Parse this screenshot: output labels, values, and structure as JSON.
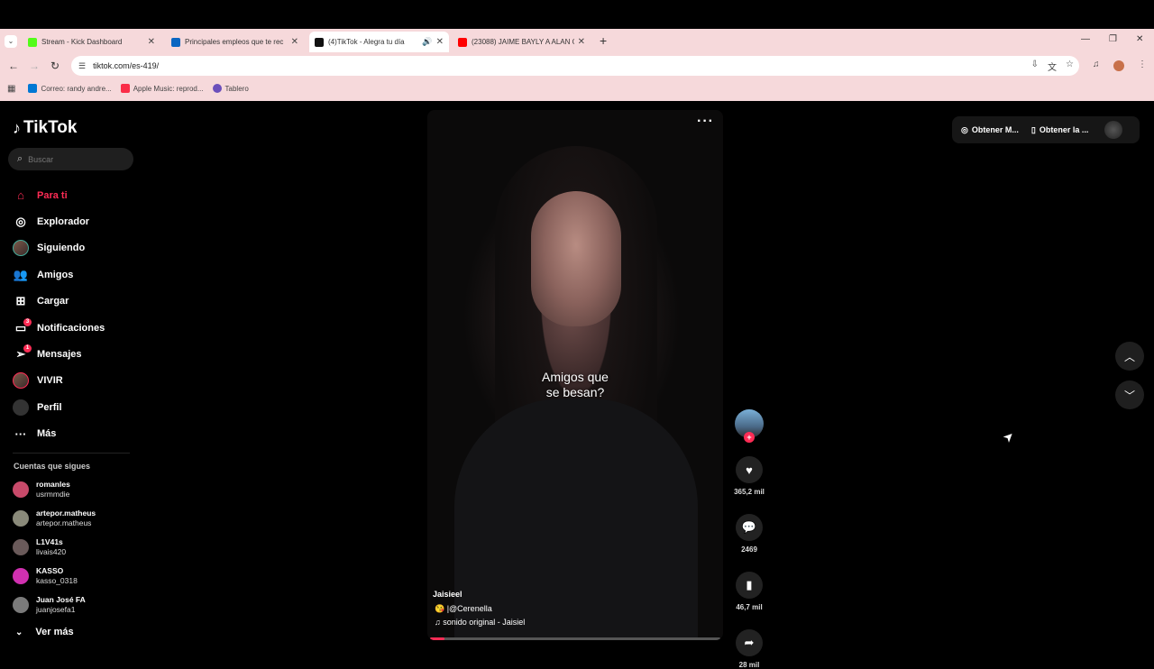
{
  "browser": {
    "tabs": [
      {
        "title": "Stream - Kick Dashboard",
        "favicon_color": "#53fc18",
        "active": false
      },
      {
        "title": "Principales empleos que te rec",
        "favicon_color": "#0a66c2",
        "active": false
      },
      {
        "title": "(4)TikTok - Alegra tu día",
        "favicon_color": "#111111",
        "active": true
      },
      {
        "title": "(23088) JAIME BAYLY A ALAN G",
        "favicon_color": "#ff0000",
        "active": false
      }
    ],
    "url": "tiktok.com/es-419/",
    "bookmarks": [
      {
        "label": "Correo: randy andre...",
        "color": "#0078d4"
      },
      {
        "label": "Apple Music: reprod...",
        "color": "#fa2d48"
      },
      {
        "label": "Tablero",
        "color": "#6b4fbb"
      }
    ]
  },
  "sidebar": {
    "logo": "TikTok",
    "search_placeholder": "Buscar",
    "nav": [
      {
        "label": "Para ti",
        "icon": "home-icon",
        "active": true
      },
      {
        "label": "Explorador",
        "icon": "compass-icon"
      },
      {
        "label": "Siguiendo",
        "icon": "following-avatar"
      },
      {
        "label": "Amigos",
        "icon": "friends-icon"
      },
      {
        "label": "Cargar",
        "icon": "upload-icon"
      },
      {
        "label": "Notificaciones",
        "icon": "inbox-icon",
        "badge": "3"
      },
      {
        "label": "Mensajes",
        "icon": "send-icon",
        "badge": "1"
      },
      {
        "label": "VIVIR",
        "icon": "live-icon"
      },
      {
        "label": "Perfil",
        "icon": "profile-avatar"
      },
      {
        "label": "Más",
        "icon": "more-icon"
      }
    ],
    "following_title": "Cuentas que sigues",
    "following": [
      {
        "name": "romanles",
        "handle": "usrmmdie",
        "color": "#c84a6a"
      },
      {
        "name": "artepor.matheus",
        "handle": "artepor.matheus",
        "color": "#8a8a7a"
      },
      {
        "name": "L1V41s",
        "handle": "livais420",
        "color": "#6a5a5a"
      },
      {
        "name": "KASSO",
        "handle": "kasso_0318",
        "color": "#d030b0"
      },
      {
        "name": "Juan José FA",
        "handle": "juanjosefa1",
        "color": "#7a7a7a"
      }
    ],
    "see_more": "Ver más"
  },
  "video": {
    "caption_line1": "Amigos que",
    "caption_line2": "se besan?",
    "author": "Jaisieel",
    "description": "😘 |@Cerenella",
    "sound": "♫ sonido original - Jaisiel",
    "progress": 0.05
  },
  "actions": {
    "likes": "365,2 mil",
    "comments": "2469",
    "saves": "46,7 mil",
    "shares": "28 mil"
  },
  "topright": {
    "btn1": "Obtener M...",
    "btn2": "Obtener la ..."
  }
}
